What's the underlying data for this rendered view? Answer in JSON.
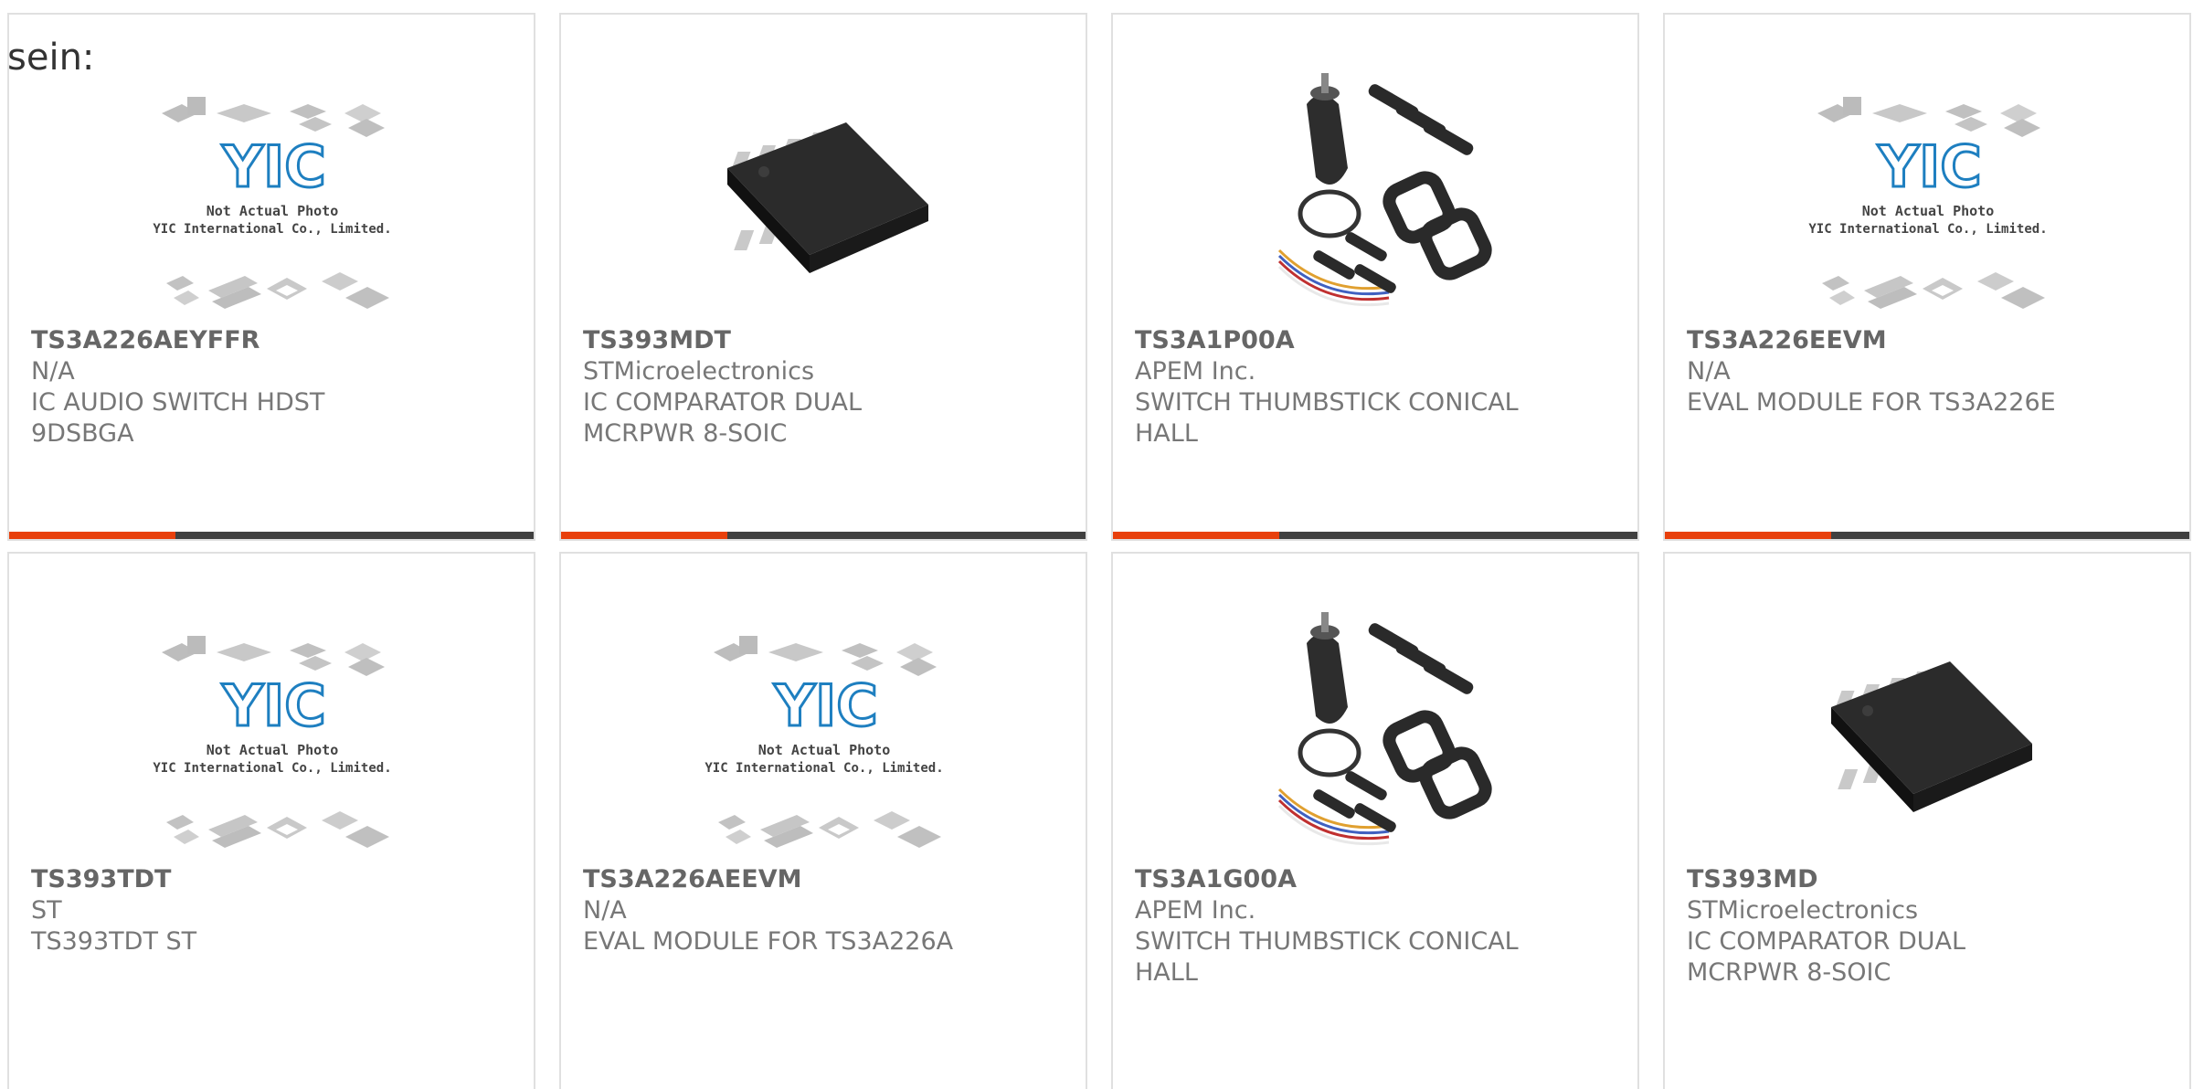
{
  "lead_text": "sein:",
  "placeholder_caption": {
    "line1": "Not Actual Photo",
    "line2": "YIC International Co., Limited.",
    "logo": "YIC"
  },
  "colors": {
    "accent": "#e8400c",
    "bar_dark": "#404040",
    "logo_blue": "#1e7fc0"
  },
  "products": [
    {
      "part": "TS3A226AEYFFR",
      "manufacturer": "N/A",
      "desc": "IC AUDIO SWITCH HDST 9DSBGA",
      "image": "placeholder-photo"
    },
    {
      "part": "TS393MDT",
      "manufacturer": "STMicroelectronics",
      "desc": "IC COMPARATOR DUAL MCRPWR 8-SOIC",
      "image": "soic-chip-photo"
    },
    {
      "part": "TS3A1P00A",
      "manufacturer": "APEM Inc.",
      "desc": "SWITCH THUMBSTICK CONICAL HALL",
      "image": "thumbstick-kit-photo"
    },
    {
      "part": "TS3A226EEVM",
      "manufacturer": "N/A",
      "desc": "EVAL MODULE FOR TS3A226E",
      "image": "placeholder-photo"
    },
    {
      "part": "TS393TDT",
      "manufacturer": "ST",
      "desc": "TS393TDT ST",
      "image": "placeholder-photo"
    },
    {
      "part": "TS3A226AEEVM",
      "manufacturer": "N/A",
      "desc": "EVAL MODULE FOR TS3A226A",
      "image": "placeholder-photo"
    },
    {
      "part": "TS3A1G00A",
      "manufacturer": "APEM Inc.",
      "desc": "SWITCH THUMBSTICK CONICAL HALL",
      "image": "thumbstick-kit-photo"
    },
    {
      "part": "TS393MD",
      "manufacturer": "STMicroelectronics",
      "desc": "IC COMPARATOR DUAL MCRPWR 8-SOIC",
      "image": "soic-chip-photo"
    }
  ]
}
